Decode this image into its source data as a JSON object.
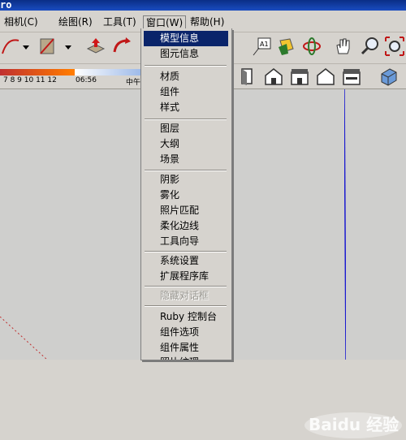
{
  "window": {
    "title_fragment": "ro"
  },
  "menubar": {
    "items": [
      "相机(C)",
      "绘图(R)",
      "工具(T)",
      "窗口(W)",
      "帮助(H)"
    ]
  },
  "toolbar2": {
    "scale": "7 8 9 10 11 12",
    "time": "06:56",
    "noon": "中午"
  },
  "dropdown": {
    "groups": [
      [
        "模型信息",
        "图元信息"
      ],
      [
        "材质",
        "组件",
        "样式"
      ],
      [
        "图层",
        "大纲",
        "场景"
      ],
      [
        "阴影",
        "雾化",
        "照片匹配",
        "柔化边线",
        "工具向导"
      ],
      [
        "系统设置",
        "扩展程序库"
      ],
      [
        "隐藏对话框"
      ],
      [
        "Ruby 控制台",
        "组件选项",
        "组件属性",
        "照片纹理"
      ]
    ],
    "highlighted": "模型信息",
    "disabled": "隐藏对话框"
  },
  "watermark": {
    "text": "Baidu 经验"
  },
  "icons": {
    "toolbar": [
      "arc-icon",
      "shape-icon",
      "push-pull-icon",
      "follow-me-icon",
      "text-label-icon",
      "paint-icon",
      "orbit-icon",
      "pan-icon",
      "zoom-icon",
      "zoom-extents-icon"
    ],
    "views": [
      "view-left-icon",
      "view-iso-house-icon",
      "view-front-icon",
      "view-right-icon",
      "view-back-icon",
      "view-top-icon",
      "view-3d-icon"
    ]
  },
  "colors": {
    "highlight": "#0a246a",
    "axis_blue": "#1a1ad0",
    "axis_red": "#c03030"
  }
}
